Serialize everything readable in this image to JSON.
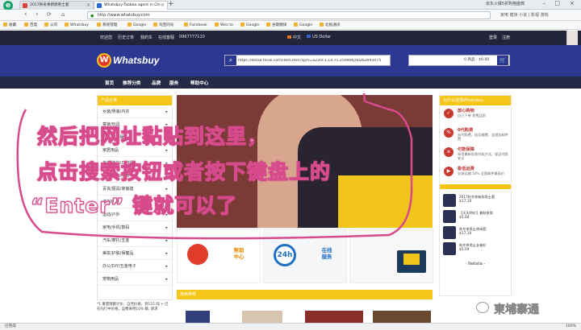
{
  "browser": {
    "tabs": [
      {
        "label": "2017秋冬季新款男士套"
      },
      {
        "label": "Whatsbuy-Taobao agent in Chi"
      }
    ],
    "new_tab": "+",
    "right_text": "京东火爆5折购物盛典",
    "url": "http://www.whatsbuy.com",
    "toolbar_right": "家电 健身 小说 | 影视 游戏",
    "bookmarks": [
      "收藏",
      "百度",
      "公司",
      "Whatsbuy",
      "系统管理",
      "Google",
      "淘宝同号",
      "Facebook",
      "Weo to",
      "Google",
      "谷歌翻译",
      "Google",
      "北极通讯"
    ],
    "status": "已完成",
    "zoom": "100%"
  },
  "site": {
    "top_links": [
      "欢迎您",
      "历史订单",
      "我的车",
      "在线客服",
      "0967777110"
    ],
    "lang": "中文",
    "currency": "US Dollar",
    "auth": [
      "登录",
      "注册"
    ],
    "logo_text": "Whatsbuy",
    "search_value": "https://detail.tmall.com/item.htm?spm=a220r.1.14.71.25d906jrkadudr93075",
    "cart_text": "0 商品 - $0.00",
    "nav": [
      "首页",
      "推荐分类",
      "品牌",
      "服务",
      "帮助中心"
    ],
    "categories_head": "产品分类",
    "categories": [
      "女装/男装/内衣",
      "童装/玩具",
      "内衣/家居服",
      "家居用品",
      "美妆/洗护/口腔保",
      "箱包/配饰/手表",
      "百货/厨具/家装建",
      "虚拟商品",
      "运动/户外",
      "家电/手机/数码",
      "汽车/摩托/五金",
      "美妆/护肤/保健品",
      "办公/DIY/五金电子",
      "宠物用品"
    ],
    "cat_note": "*1 重量限额计价，自然价格，到115 吨 + 已在同行中价格，运费采用10% 额,  请求",
    "tiles": [
      {
        "label": "帮助\n中心"
      },
      {
        "label": "在线\n服务"
      }
    ],
    "section_hot": "热卖推荐",
    "right_head": "为什么选择Whatsbuy",
    "right_items": [
      {
        "title": "放心购物",
        "sub": "自己下单 免费品质"
      },
      {
        "title": "0代购费",
        "sub": "无代购费，低运输费，全国包邮件费"
      },
      {
        "title": "付款保障",
        "sub": "采用最新交易付款方式，保证付款安全"
      },
      {
        "title": "极低运费",
        "sub": "全球运输 10% 全国邮件最高价"
      }
    ],
    "right_products": [
      {
        "name": "2017秋冬季新款男士套",
        "price": "$17.10"
      },
      {
        "name": "【天天特价】春秋季男",
        "price": "$5.04"
      },
      {
        "name": "秋冬季男士休闲套",
        "price": "$17.10"
      },
      {
        "name": "秋冬季男士长袖衫",
        "price": "$5.04"
      }
    ],
    "right_footer": "- Natalia -"
  },
  "annotation": {
    "line1": "然后把网址黏贴到这里，",
    "line2": "点击搜索按钮或者按下键盘上的",
    "line3": "“Enter” 键就可以了"
  },
  "watermark": "柬埔寨通",
  "colors": {
    "header": "#2c3892",
    "accent": "#f5c518",
    "annotation": "#d74b8c"
  }
}
